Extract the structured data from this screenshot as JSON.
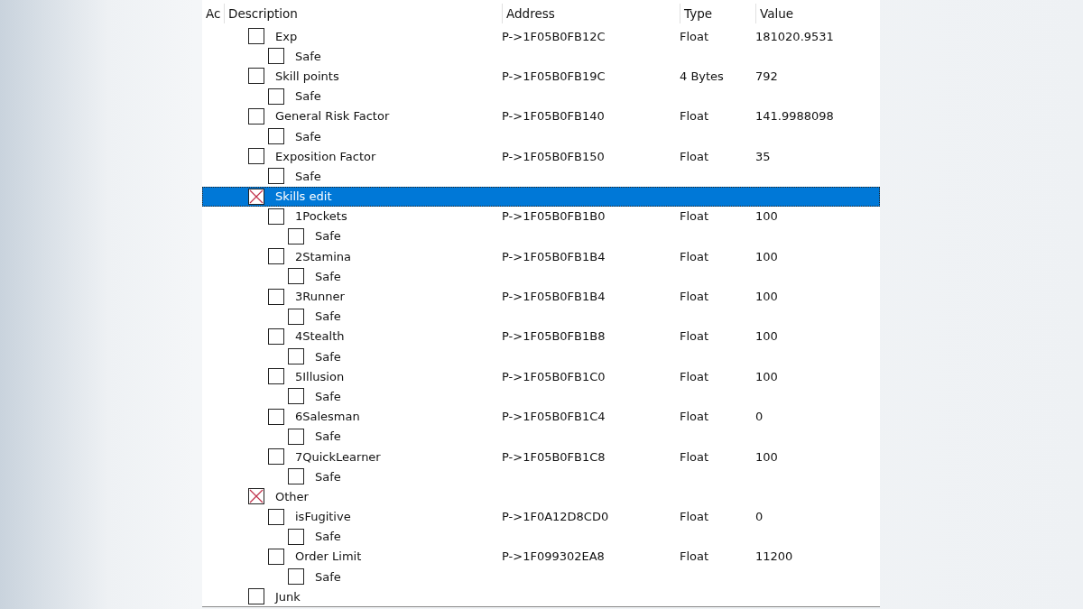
{
  "columns": [
    "Ac",
    "Description",
    "Address",
    "Type",
    "Value"
  ],
  "entries": [
    {
      "description": "Exp",
      "address": "P->1F05B0FB12C",
      "type": "Float",
      "value": "181020.9531",
      "checked": false,
      "selected": false,
      "children": [
        {
          "description": "Safe",
          "checked": false,
          "selected": false
        }
      ]
    },
    {
      "description": "Skill points",
      "address": "P->1F05B0FB19C",
      "type": "4 Bytes",
      "value": "792",
      "checked": false,
      "selected": false,
      "children": [
        {
          "description": "Safe",
          "checked": false,
          "selected": false
        }
      ]
    },
    {
      "description": "General Risk Factor",
      "address": "P->1F05B0FB140",
      "type": "Float",
      "value": "141.9988098",
      "checked": false,
      "selected": false,
      "children": [
        {
          "description": "Safe",
          "checked": false,
          "selected": false
        }
      ]
    },
    {
      "description": "Exposition Factor",
      "address": "P->1F05B0FB150",
      "type": "Float",
      "value": "35",
      "checked": false,
      "selected": false,
      "children": [
        {
          "description": "Safe",
          "checked": false,
          "selected": false
        }
      ]
    },
    {
      "description": "Skills edit",
      "checked": true,
      "selected": true,
      "children": [
        {
          "description": "1Pockets",
          "address": "P->1F05B0FB1B0",
          "type": "Float",
          "value": "100",
          "checked": false,
          "selected": false,
          "children": [
            {
              "description": "Safe",
              "checked": false,
              "selected": false
            }
          ]
        },
        {
          "description": "2Stamina",
          "address": "P->1F05B0FB1B4",
          "type": "Float",
          "value": "100",
          "checked": false,
          "selected": false,
          "children": [
            {
              "description": "Safe",
              "checked": false,
              "selected": false
            }
          ]
        },
        {
          "description": "3Runner",
          "address": "P->1F05B0FB1B4",
          "type": "Float",
          "value": "100",
          "checked": false,
          "selected": false,
          "children": [
            {
              "description": "Safe",
              "checked": false,
              "selected": false
            }
          ]
        },
        {
          "description": "4Stealth",
          "address": "P->1F05B0FB1B8",
          "type": "Float",
          "value": "100",
          "checked": false,
          "selected": false,
          "children": [
            {
              "description": "Safe",
              "checked": false,
              "selected": false
            }
          ]
        },
        {
          "description": "5Illusion",
          "address": "P->1F05B0FB1C0",
          "type": "Float",
          "value": "100",
          "checked": false,
          "selected": false,
          "children": [
            {
              "description": "Safe",
              "checked": false,
              "selected": false
            }
          ]
        },
        {
          "description": "6Salesman",
          "address": "P->1F05B0FB1C4",
          "type": "Float",
          "value": "0",
          "checked": false,
          "selected": false,
          "children": [
            {
              "description": "Safe",
              "checked": false,
              "selected": false
            }
          ]
        },
        {
          "description": "7QuickLearner",
          "address": "P->1F05B0FB1C8",
          "type": "Float",
          "value": "100",
          "checked": false,
          "selected": false,
          "children": [
            {
              "description": "Safe",
              "checked": false,
              "selected": false
            }
          ]
        }
      ]
    },
    {
      "description": "Other",
      "checked": true,
      "selected": false,
      "children": [
        {
          "description": "isFugitive",
          "address": "P->1F0A12D8CD0",
          "type": "Float",
          "value": "0",
          "checked": false,
          "selected": false,
          "children": [
            {
              "description": "Safe",
              "checked": false,
              "selected": false
            }
          ]
        },
        {
          "description": "Order Limit",
          "address": "P->1F099302EA8",
          "type": "Float",
          "value": "11200",
          "checked": false,
          "selected": false,
          "children": [
            {
              "description": "Safe",
              "checked": false,
              "selected": false
            }
          ]
        }
      ]
    },
    {
      "description": "Junk",
      "checked": false,
      "selected": false
    }
  ]
}
